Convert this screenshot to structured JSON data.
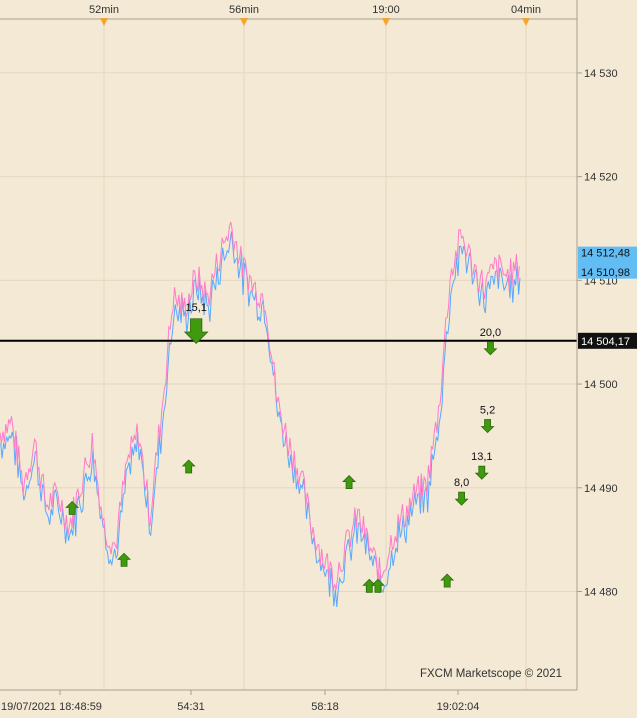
{
  "colors": {
    "background": "#f3e9d4",
    "grid": "#e6d8bd",
    "axis": "#a89f8f",
    "series_pink": "#ff7bc8",
    "series_blue": "#58a8ff",
    "reference_line": "#000000",
    "bid_label": "#63bdf5",
    "ref_label": "#111111",
    "arrow_green": "#3f9a10",
    "top_marker": "#f3a32e"
  },
  "watermark": "FXCM Marketscope © 2021",
  "chart_data": {
    "type": "line",
    "top_time_labels": [
      "52min",
      "56min",
      "19:00",
      "04min"
    ],
    "bottom_time_labels": [
      "19/07/2021 18:48:59",
      "54:31",
      "58:18",
      "19:02:04"
    ],
    "y_ticks": [
      "14 530",
      "14 520",
      "14 510",
      "14 500",
      "14 490",
      "14 480"
    ],
    "y_tick_values": [
      14530,
      14520,
      14510,
      14500,
      14490,
      14480
    ],
    "ylim": [
      14470.5,
      14535.2
    ],
    "x_range": [
      0,
      100
    ],
    "current_labels": [
      {
        "text": "14 512,48",
        "value": 14512.48
      },
      {
        "text": "14 510,98",
        "value": 14510.98
      }
    ],
    "reference_line": {
      "value": 14504.17,
      "label": "14 504,17"
    },
    "series": [
      {
        "x": [
          0,
          2,
          4,
          6,
          8,
          10,
          12,
          14,
          16,
          18,
          20,
          22,
          24,
          26,
          28,
          30,
          32,
          34,
          36,
          38,
          40,
          42,
          44,
          46,
          48,
          50,
          52,
          54,
          56,
          58,
          60,
          62,
          64,
          66,
          68,
          70,
          72,
          74,
          76,
          78,
          80,
          82,
          84,
          86,
          88,
          90
        ],
        "values": [
          14495,
          14496,
          14490,
          14494,
          14488,
          14489,
          14486,
          14490,
          14494,
          14486,
          14484,
          14492,
          14495,
          14487,
          14497,
          14508,
          14507,
          14510,
          14508,
          14512,
          14515,
          14511,
          14509,
          14508,
          14498,
          14494,
          14491,
          14486,
          14483,
          14481,
          14484,
          14487,
          14484,
          14481,
          14485,
          14487,
          14489,
          14490,
          14497,
          14510,
          14514,
          14511,
          14509,
          14511,
          14510,
          14511
        ]
      }
    ],
    "signals": [
      {
        "x": 12.5,
        "value": 14488,
        "dir": "up"
      },
      {
        "x": 21.5,
        "value": 14483,
        "dir": "up"
      },
      {
        "x": 32.7,
        "value": 14492,
        "dir": "up"
      },
      {
        "x": 34,
        "value": 14505.2,
        "dir": "down",
        "big": true,
        "label": "15,1"
      },
      {
        "x": 60.5,
        "value": 14490.5,
        "dir": "up"
      },
      {
        "x": 64,
        "value": 14480.5,
        "dir": "up"
      },
      {
        "x": 65.5,
        "value": 14480.5,
        "dir": "up"
      },
      {
        "x": 77.5,
        "value": 14481,
        "dir": "up"
      },
      {
        "x": 80,
        "value": 14489,
        "dir": "down",
        "label": "8,0"
      },
      {
        "x": 83.5,
        "value": 14491.5,
        "dir": "down",
        "label": "13,1"
      },
      {
        "x": 84.5,
        "value": 14496,
        "dir": "down",
        "label": "5,2"
      },
      {
        "x": 85,
        "value": 14503.5,
        "dir": "down",
        "label": "20,0"
      }
    ]
  }
}
